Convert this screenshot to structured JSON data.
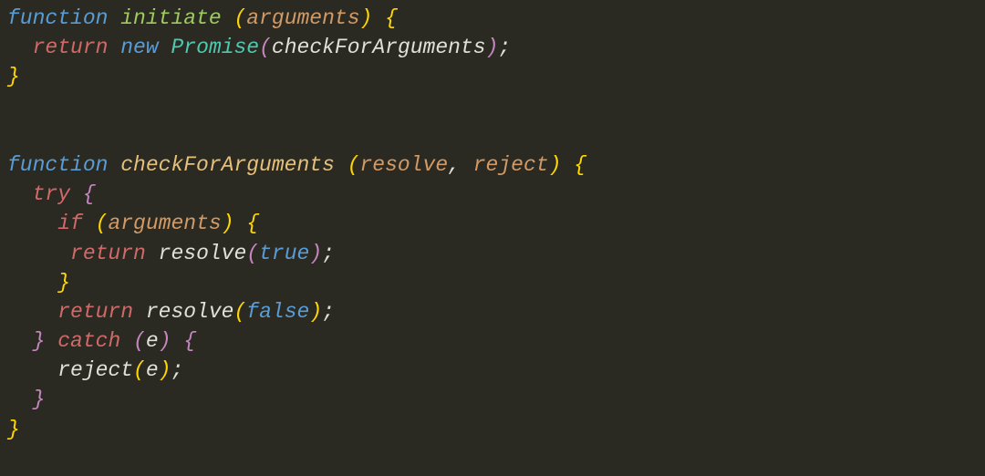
{
  "code": {
    "line1": {
      "kw_function": "function",
      "fn_initiate": "initiate",
      "param_arguments": "arguments"
    },
    "line2": {
      "kw_return": "return",
      "kw_new": "new",
      "class_promise": "Promise",
      "arg_checkForArguments": "checkForArguments"
    },
    "line6": {
      "kw_function": "function",
      "fn_checkForArguments": "checkForArguments",
      "param_resolve": "resolve",
      "param_reject": "reject"
    },
    "line7": {
      "kw_try": "try"
    },
    "line8": {
      "kw_if": "if",
      "param_arguments": "arguments"
    },
    "line9": {
      "kw_return": "return",
      "fn_resolve": "resolve",
      "val_true": "true"
    },
    "line11": {
      "kw_return": "return",
      "fn_resolve": "resolve",
      "val_false": "false"
    },
    "line12": {
      "kw_catch": "catch",
      "param_e": "e"
    },
    "line13": {
      "fn_reject": "reject",
      "arg_e": "e"
    }
  }
}
